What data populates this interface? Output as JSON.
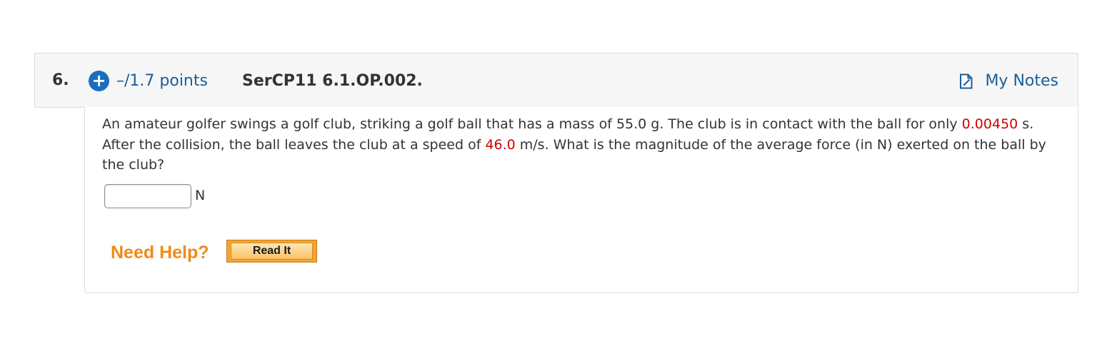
{
  "question": {
    "number": "6.",
    "points": "–/1.7 points",
    "code": "SerCP11 6.1.OP.002.",
    "my_notes_label": "My Notes",
    "text": {
      "part1": "An amateur golfer swings a golf club, striking a golf ball that has a mass of 55.0 g. The club is in contact with the ball for only ",
      "time_value": "0.00450",
      "part2": " s. After the collision, the ball leaves the club at a speed of ",
      "speed_value": "46.0",
      "part3": " m/s. What is the magnitude of the average force (in N) exerted on the ball by the club?"
    },
    "answer": {
      "value": "",
      "unit": "N"
    },
    "help": {
      "label": "Need Help?",
      "read_it_label": "Read It"
    }
  },
  "icons": {
    "expand": "plus-circle-icon",
    "notes": "notes-icon"
  },
  "colors": {
    "link_blue": "#1a5e9a",
    "plus_blue": "#1a6ebd",
    "highlight_red": "#d10000",
    "help_orange": "#f08a17",
    "button_orange": "#f6a431",
    "header_bg": "#f6f6f6"
  }
}
